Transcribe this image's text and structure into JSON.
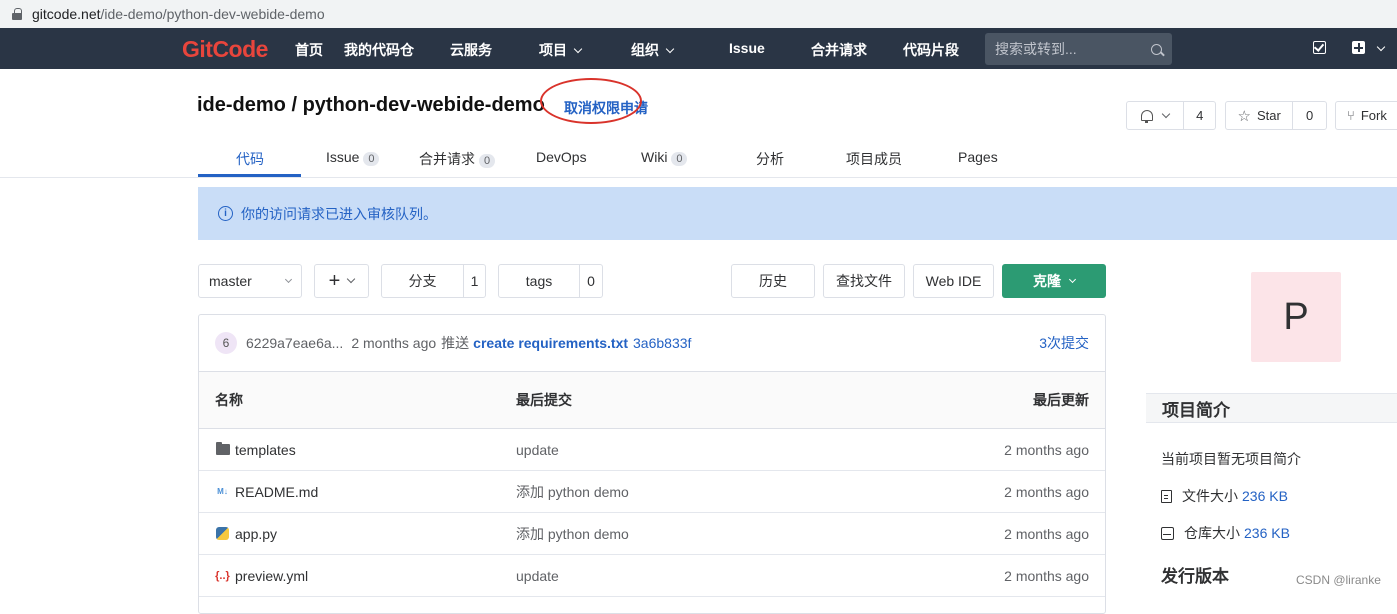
{
  "url": {
    "host": "gitcode.net",
    "path": "/ide-demo/python-dev-webide-demo"
  },
  "nav": {
    "logo_g": "G",
    "logo_rest": "itCode",
    "items": [
      "首页",
      "我的代码仓",
      "云服务",
      "项目",
      "组织",
      "Issue",
      "合并请求",
      "代码片段"
    ],
    "search_placeholder": "搜索或转到..."
  },
  "project": {
    "title": "ide-demo / python-dev-webide-demo",
    "cancel_request": "取消权限申请",
    "notify_count": "4",
    "star_label": "Star",
    "star_count": "0",
    "fork_label": "Fork"
  },
  "tabs": [
    {
      "label": "代码",
      "badge": null
    },
    {
      "label": "Issue",
      "badge": "0"
    },
    {
      "label": "合并请求",
      "badge": "0"
    },
    {
      "label": "DevOps",
      "badge": null
    },
    {
      "label": "Wiki",
      "badge": "0"
    },
    {
      "label": "分析",
      "badge": null
    },
    {
      "label": "项目成员",
      "badge": null
    },
    {
      "label": "Pages",
      "badge": null
    }
  ],
  "alert": {
    "text": "你的访问请求已进入审核队列。"
  },
  "toolbar": {
    "branch": "master",
    "branches_label": "分支",
    "branches_count": "1",
    "tags_label": "tags",
    "tags_count": "0",
    "history": "历史",
    "find_file": "查找文件",
    "web_ide": "Web IDE",
    "clone": "克隆"
  },
  "commit": {
    "avatar": "6",
    "author": "6229a7eae6a...",
    "time": "2 months ago",
    "action": "推送",
    "message": "create requirements.txt",
    "sha": "3a6b833f",
    "count": "3次提交"
  },
  "table": {
    "headers": [
      "名称",
      "最后提交",
      "最后更新"
    ],
    "rows": [
      {
        "name": "templates",
        "icon": "folder-icon",
        "commit": "update",
        "updated": "2 months ago"
      },
      {
        "name": "README.md",
        "icon": "markdown-icon",
        "commit": "添加 python demo",
        "updated": "2 months ago"
      },
      {
        "name": "app.py",
        "icon": "python-icon",
        "commit": "添加 python demo",
        "updated": "2 months ago"
      },
      {
        "name": "preview.yml",
        "icon": "yaml-icon",
        "commit": "update",
        "updated": "2 months ago"
      }
    ]
  },
  "sidebar": {
    "avatar_letter": "P",
    "intro_heading": "项目简介",
    "intro_text": "当前项目暂无项目简介",
    "file_size_label": "文件大小",
    "file_size": "236 KB",
    "repo_size_label": "仓库大小",
    "repo_size": "236 KB",
    "releases_heading": "发行版本"
  },
  "watermark": "CSDN @liranke",
  "colors": {
    "nav_bg": "#2a3545",
    "accent": "#2462c4",
    "clone_green": "#2c9b73",
    "alert_bg": "#c9ddf7",
    "annotation_red": "#d9332b"
  }
}
